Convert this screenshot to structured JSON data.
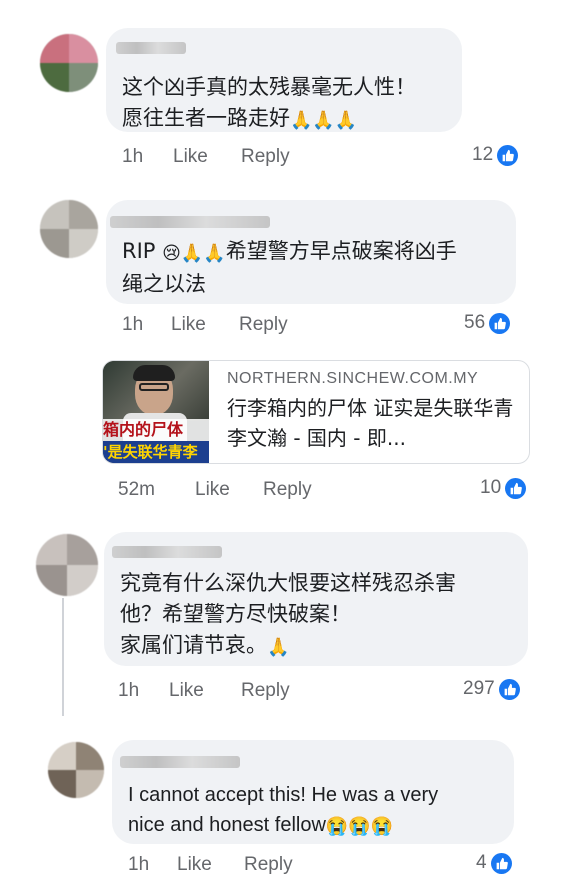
{
  "comments": [
    {
      "text": "这个凶手真的太残暴毫无人性！\n愿往生者一路走好",
      "emoji": "🙏🙏🙏",
      "time": "1h",
      "like": "Like",
      "reply": "Reply",
      "reactions": "12"
    },
    {
      "text_prefix": "RIP ",
      "emoji": "😢🙏🙏",
      "text": "希望警方早点破案将凶手\n绳之以法",
      "time": "1h",
      "like": "Like",
      "reply": "Reply",
      "reactions": "56"
    },
    {
      "time": "52m",
      "like": "Like",
      "reply": "Reply",
      "reactions": "10"
    },
    {
      "text": "究竟有什么深仇大恨要这样残忍杀害\n他？希望警方尽快破案！\n家属们请节哀。",
      "emoji": "🙏",
      "time": "1h",
      "like": "Like",
      "reply": "Reply",
      "reactions": "297"
    },
    {
      "text": "I cannot accept this! He was a very\nnice and honest fellow",
      "emoji": "😭😭😭",
      "time": "1h",
      "like": "Like",
      "reply": "Reply",
      "reactions": "4"
    }
  ],
  "link_preview": {
    "domain": "NORTHERN.SINCHEW.COM.MY",
    "title": "行李箱内的尸体 证实是失联华青李文瀚 - 国内 - 即...",
    "thumb_caption_1": "箱内的尸体",
    "thumb_caption_2": "'是失联华青李"
  },
  "colors": {
    "bubble": "#f0f2f5",
    "meta": "#65676b",
    "like_blue": "#1877f2"
  },
  "icons": [
    "like-reaction-icon",
    "praying-hands-emoji",
    "crying-face-emoji",
    "sad-face-emoji"
  ]
}
